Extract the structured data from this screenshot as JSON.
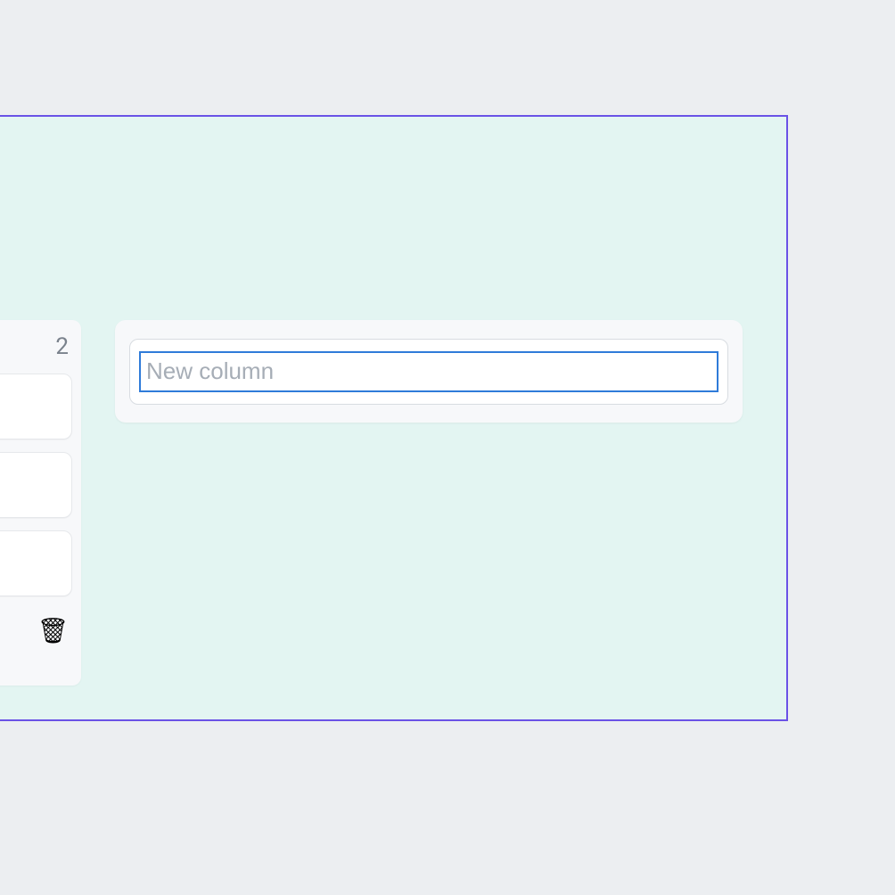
{
  "board": {
    "existing_column": {
      "count": "2",
      "cards": [
        "",
        "",
        ""
      ],
      "trash_icon": "🗑"
    },
    "new_column": {
      "placeholder": "New column",
      "value": ""
    }
  }
}
